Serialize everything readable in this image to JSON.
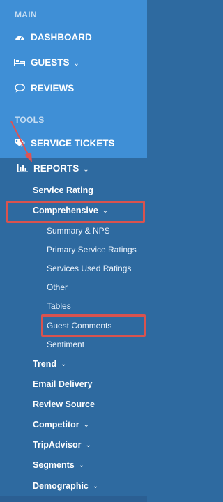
{
  "sections": {
    "main": "MAIN",
    "tools": "TOOLS"
  },
  "nav": {
    "dashboard": "DASHBOARD",
    "guests": "GUESTS",
    "reviews": "REVIEWS",
    "service_tickets": "SERVICE TICKETS",
    "reports": "REPORTS"
  },
  "chevron": "⌄",
  "reports_menu": {
    "service_rating": "Service Rating",
    "comprehensive": "Comprehensive",
    "comprehensive_items": [
      "Summary & NPS",
      "Primary Service Ratings",
      "Services Used Ratings",
      "Other",
      "Tables",
      "Guest Comments",
      "Sentiment"
    ],
    "trend": "Trend",
    "email_delivery": "Email Delivery",
    "review_source": "Review Source",
    "competitor": "Competitor",
    "tripadvisor": "TripAdvisor",
    "segments": "Segments",
    "demographic": "Demographic"
  },
  "colors": {
    "top_bg": "#3f8fd6",
    "submenu_bg": "#2e6aa0",
    "highlight": "#d9534f",
    "arrow": "#e05252"
  }
}
